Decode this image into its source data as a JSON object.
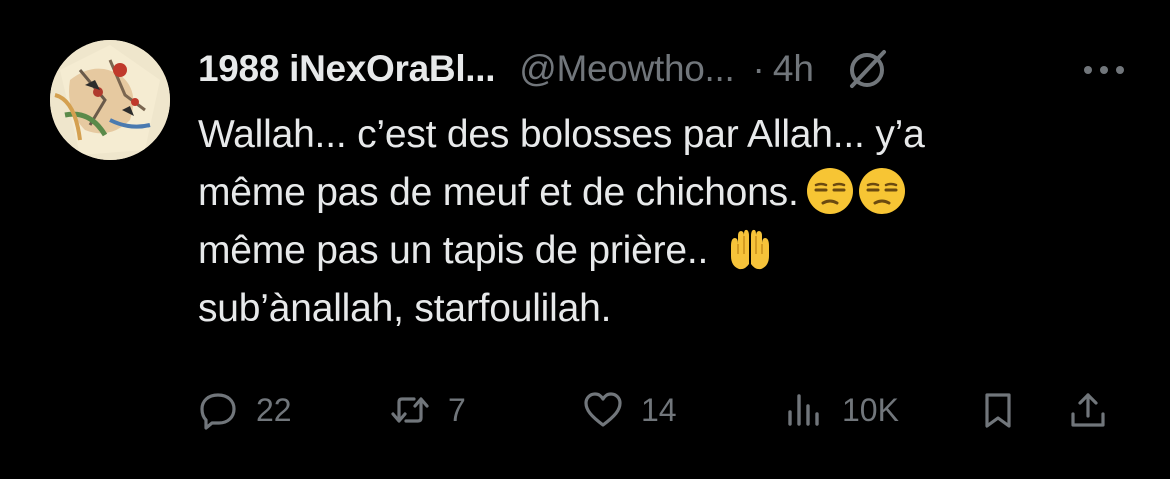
{
  "tweet": {
    "display_name": "1988 iNexOraBl...",
    "handle": "@Meowtho...",
    "separator": "·",
    "time": "4h",
    "lines": [
      "Wallah... c’est des bolosses par Allah... y’a",
      "même pas de meuf et de chichons.",
      "même pas un tapis de prière..",
      "sub’ànallah, starfoulilah."
    ],
    "emojis": [
      "unamused-face-emoji",
      "unamused-face-emoji",
      "raising-hands-emoji"
    ]
  },
  "actions": {
    "replies": "22",
    "retweets": "7",
    "likes": "14",
    "views": "10K"
  },
  "icons": {
    "reply": "reply-icon",
    "retweet": "retweet-icon",
    "like": "heart-icon",
    "views": "views-icon",
    "bookmark": "bookmark-icon",
    "share": "share-icon",
    "grok": "grok-icon",
    "more": "more-icon"
  },
  "colors": {
    "background": "#000000",
    "text": "#e7e9ea",
    "secondary": "#71767b"
  }
}
